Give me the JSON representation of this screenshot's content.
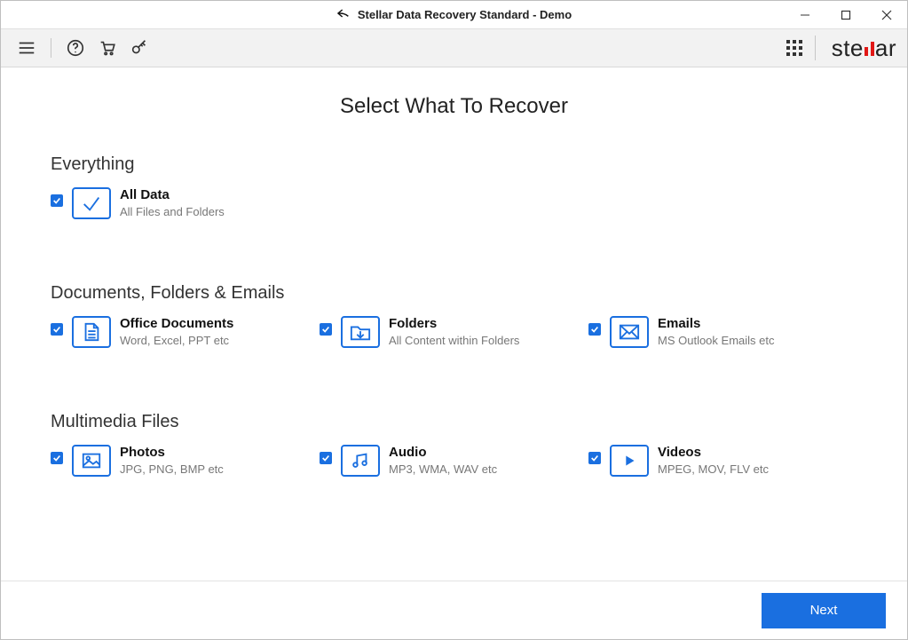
{
  "window": {
    "title": "Stellar Data Recovery Standard - Demo"
  },
  "brand": "stellar",
  "page": {
    "title": "Select What To Recover"
  },
  "sections": {
    "everything": {
      "heading": "Everything",
      "allData": {
        "title": "All Data",
        "desc": "All Files and Folders",
        "checked": true
      }
    },
    "docs": {
      "heading": "Documents, Folders & Emails",
      "office": {
        "title": "Office Documents",
        "desc": "Word, Excel, PPT etc",
        "checked": true
      },
      "folders": {
        "title": "Folders",
        "desc": "All Content within Folders",
        "checked": true
      },
      "emails": {
        "title": "Emails",
        "desc": "MS Outlook Emails etc",
        "checked": true
      }
    },
    "media": {
      "heading": "Multimedia Files",
      "photos": {
        "title": "Photos",
        "desc": "JPG, PNG, BMP etc",
        "checked": true
      },
      "audio": {
        "title": "Audio",
        "desc": "MP3, WMA, WAV etc",
        "checked": true
      },
      "videos": {
        "title": "Videos",
        "desc": "MPEG, MOV, FLV etc",
        "checked": true
      }
    }
  },
  "footer": {
    "next": "Next"
  }
}
